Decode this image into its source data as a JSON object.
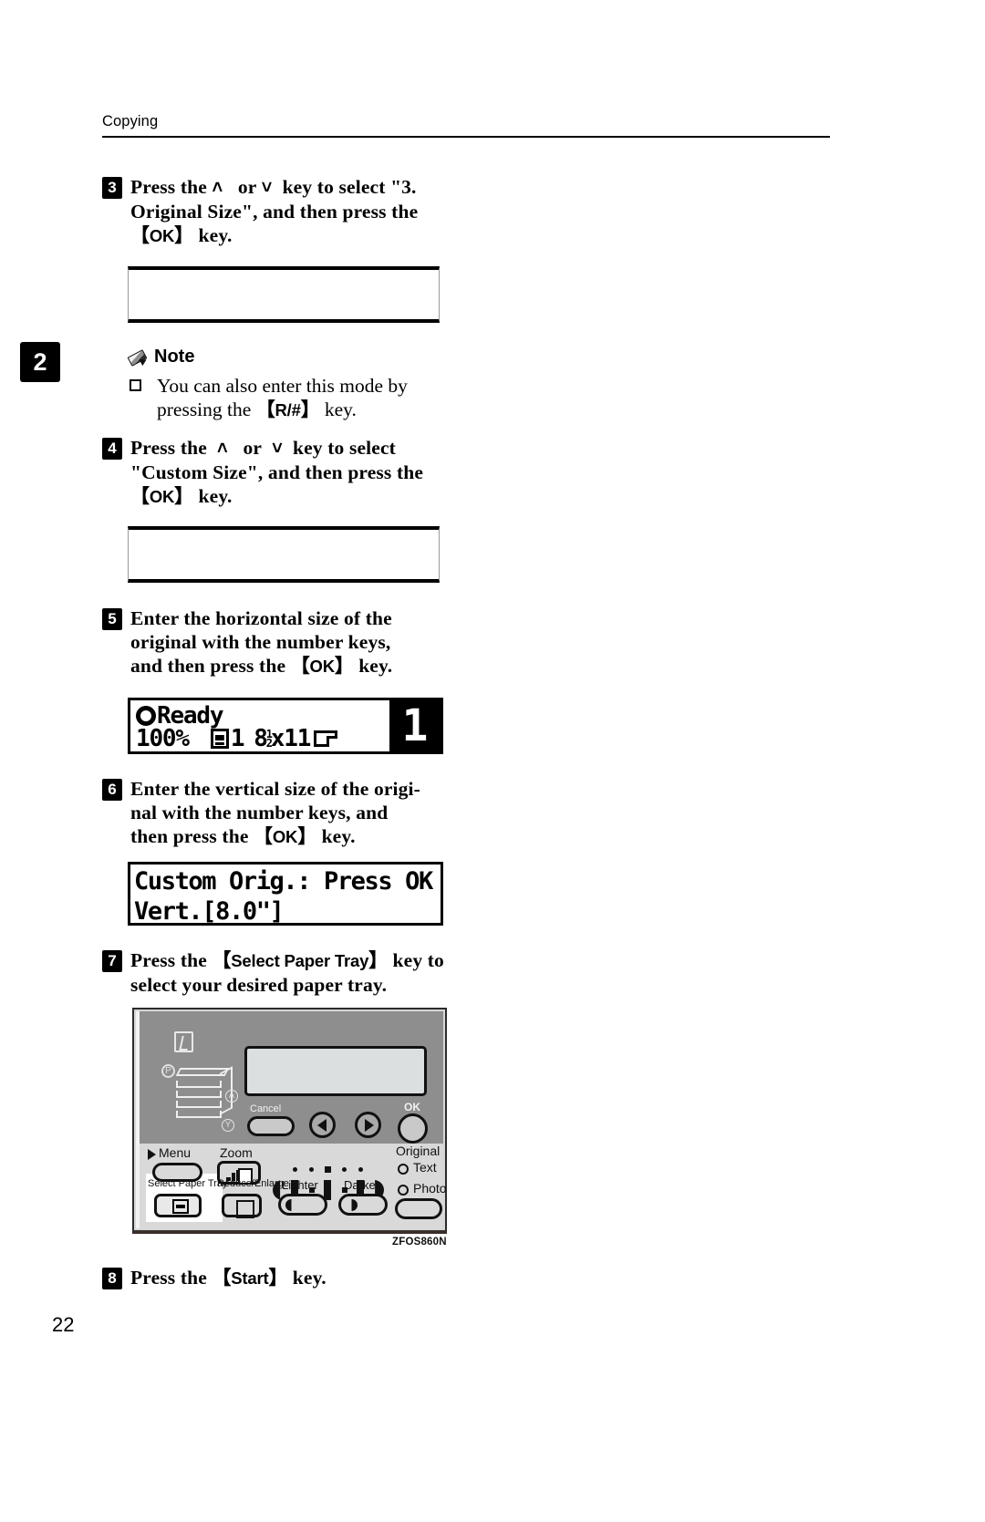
{
  "page": {
    "running_head": "Copying",
    "chapter_tab": "2",
    "page_number": "22"
  },
  "steps": [
    {
      "number": "3",
      "text_parts": [
        "Press the ",
        "˄",
        " or ",
        "˅",
        " key to select \"3. Original Size\", and then press the ",
        "【OK】",
        " key."
      ],
      "plain": "Press the ˄ or ˅ key to select \"3. Original Size\", and then press the 【OK】 key."
    },
    {
      "number": "4",
      "plain": "Press the ˄ or ˅ key to select \"Custom Size\", and then press the 【OK】 key."
    },
    {
      "number": "5",
      "plain": "Enter the horizontal size of the original with the number keys, and then press the 【OK】 key."
    },
    {
      "number": "6",
      "plain": "Enter the vertical size of the original with the number keys, and then press the 【OK】 key."
    },
    {
      "number": "7",
      "plain": "Press the 【Select Paper Tray】 key to select your desired paper tray."
    },
    {
      "number": "8",
      "plain": "Press the 【Start】 key."
    }
  ],
  "step3": {
    "marker": "3",
    "t1": "Press the",
    "up": "˄",
    "t2": "or",
    "down": "˅",
    "t3": "key to select \"3.",
    "line2": "Original Size\", and then press the",
    "okkey": "OK",
    "t4": "key."
  },
  "step4": {
    "marker": "4",
    "t1": "Press the",
    "up": "˄",
    "t2": "or",
    "down": "˅",
    "t3": "key to select",
    "line2": "\"Custom Size\", and then press the",
    "okkey": "OK",
    "t4": "key."
  },
  "step5": {
    "marker": "5",
    "line1": "Enter the horizontal size of the",
    "line2": "original with the number keys,",
    "line3a": "and then press the",
    "okkey": "OK",
    "line3b": "key."
  },
  "step6": {
    "marker": "6",
    "line1": "Enter the vertical size of the origi-",
    "line2": "nal with the number keys, and",
    "line3a": "then press the",
    "okkey": "OK",
    "line3b": "key."
  },
  "step7": {
    "marker": "7",
    "line1a": "Press the",
    "traykey": "Select Paper Tray",
    "line1b": "key to",
    "line2": "select your desired paper tray."
  },
  "step8": {
    "marker": "8",
    "t1": "Press the",
    "startkey": "Start",
    "t2": "key."
  },
  "note": {
    "title": "Note",
    "items": [
      {
        "line1": "You can also enter this mode by",
        "line2a": "pressing the",
        "key": "R/#",
        "line2b": "key."
      }
    ]
  },
  "lcd_ready": {
    "status": "Ready",
    "zoom": "100%",
    "tray_number": "1",
    "paper_size_whole": "8",
    "paper_size_num": "1",
    "paper_size_den": "2",
    "paper_size_rest": "x11",
    "copy_count": "1"
  },
  "lcd_custom": {
    "line1": "Custom Orig.: Press OK",
    "line2": "Vert.[8.0\"]"
  },
  "panel": {
    "figure_code": "ZFOS860N",
    "labels": {
      "cancel": "Cancel",
      "ok": "OK",
      "menu": "Menu",
      "zoom": "Zoom",
      "select_paper_tray": "Select Paper Tray",
      "reduce_enlarge": "Reduce/Enlarge",
      "lighter": "Lighter",
      "darker": "Darker",
      "original": "Original",
      "text": "Text",
      "photo": "Photo"
    },
    "machine_marks": {
      "a": "A",
      "y": "Y",
      "p": "P"
    }
  },
  "colors": {
    "panel_upper": "#8e8e8e",
    "panel_lower": "#d9d9d9",
    "display": "#dcdfdf",
    "ink": "#000000"
  }
}
